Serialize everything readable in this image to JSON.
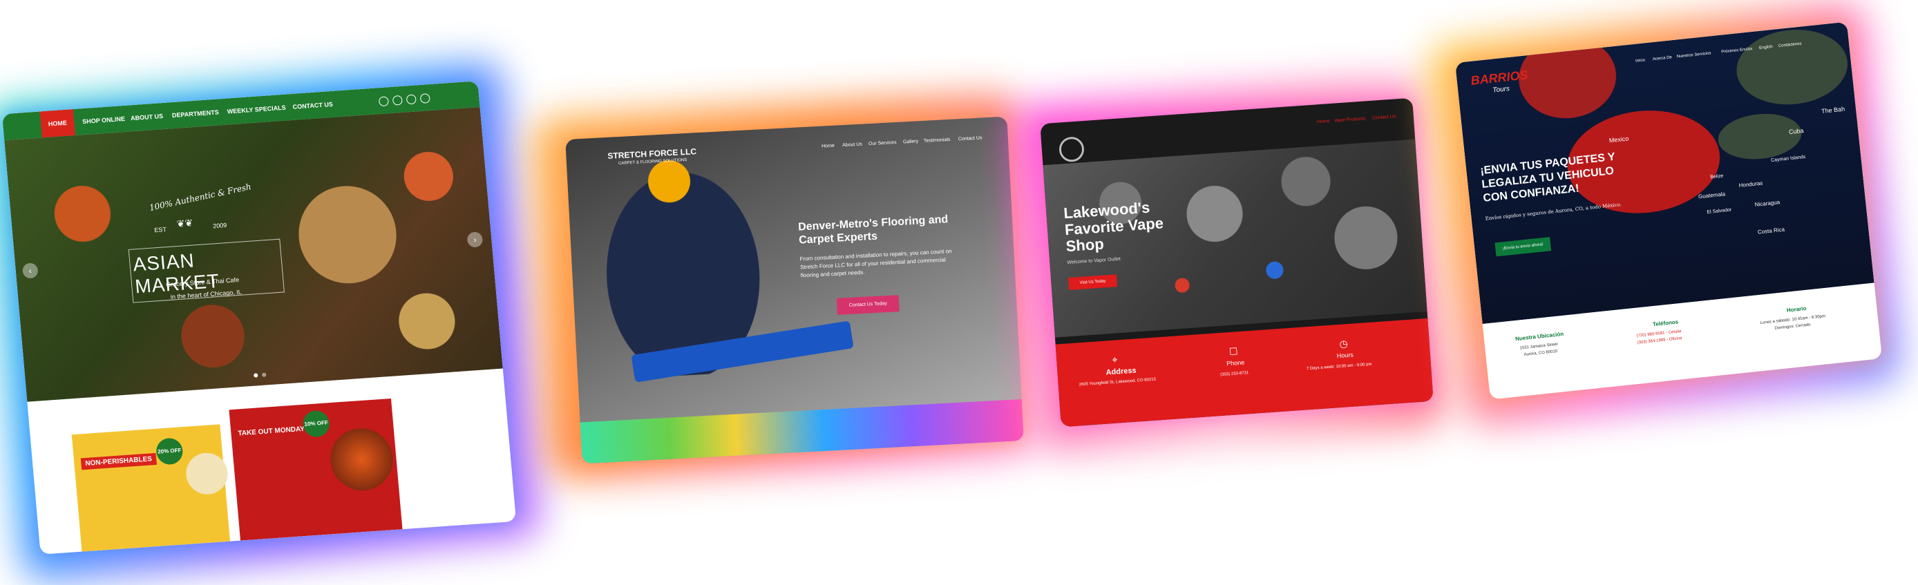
{
  "colors": {
    "asian_green": "#1f7a2e",
    "asian_red": "#d9241c",
    "stretch_pink": "#d6336c",
    "vape_red": "#e01b1b",
    "barrios_green": "#0d7a3a"
  },
  "asian": {
    "nav": [
      "HOME",
      "SHOP ONLINE",
      "ABOUT US",
      "DEPARTMENTS",
      "WEEKLY SPECIALS",
      "CONTACT US"
    ],
    "badge_line1": "100% Authentic & Fresh",
    "est": "EST",
    "year": "2009",
    "title": "ASIAN MARKET",
    "subtitle": "Grocery Store & Thai Cafe",
    "location": "in the heart of Chicago, IL",
    "promo1_label": "NON-PERISHABLES",
    "promo1_badge": "20% OFF",
    "promo2_label": "TAKE OUT MONDAYS",
    "promo2_badge": "10% OFF"
  },
  "stretch": {
    "logo": "STRETCH FORCE LLC",
    "logo_sub": "CARPET & FLOORING SOLUTIONS",
    "nav": [
      "Home",
      "About Us",
      "Our Services",
      "Gallery",
      "Testimonials",
      "Contact Us"
    ],
    "headline": "Denver-Metro's Flooring and Carpet Experts",
    "body": "From consultation and installation to repairs, you can count on Stretch Force LLC for all of your residential and commercial flooring and carpet needs.",
    "cta": "Contact Us Today"
  },
  "vape": {
    "nav": [
      "Home",
      "Vape Products",
      "Contact Us"
    ],
    "headline": "Lakewood's Favorite Vape Shop",
    "welcome": "Welcome to Vapor Outlet",
    "cta": "Visit Us Today",
    "address_label": "Address",
    "address": "2605 Youngfield St, Lakewood, CO 80215",
    "phone_label": "Phone",
    "phone": "(303) 233-8731",
    "hours_label": "Hours",
    "hours": "7 Days a week: 10:00 am - 9:00 pm"
  },
  "barrios": {
    "logo": "BARRIOS",
    "logo_sub": "Tours",
    "nav": [
      "Inicio",
      "Acerca De",
      "Nuestros Servicios",
      "Próximos Envíos",
      "English",
      "Contáctenos"
    ],
    "headline": "¡ENVIA TUS PAQUETES Y LEGALIZA TU VEHICULO CON CONFIANZA!",
    "body": "Envíos rápidos y seguros de Aurora, CO, a todo México.",
    "cta": "¡Envía tu envío ahora!",
    "map_labels": [
      "Mexico",
      "The Bah",
      "Cuba",
      "Cayman Islands",
      "Belize",
      "Honduras",
      "Guatemala",
      "El Salvador",
      "Nicaragua",
      "Costa Rica"
    ],
    "col1_title": "Nuestra Ubicación",
    "col1_l1": "1531 Jamaica Street",
    "col1_l2": "Aurora, CO 80010",
    "col2_title": "Teléfonos",
    "col2_l1": "(720) 980-9591 - Celular",
    "col2_l2": "(303) 364-1989 - Oficina",
    "col3_title": "Horario",
    "col3_l1": "Lunes a sábado: 10:45am - 6:30pm",
    "col3_l2": "Domingos: Cerrado"
  }
}
